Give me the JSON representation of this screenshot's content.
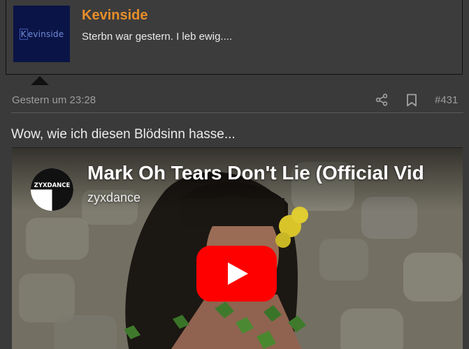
{
  "member": {
    "avatar_text": "evinside",
    "avatar_initial": "K",
    "username": "Kevinside",
    "title": "Sterbn war gestern. I leb ewig...."
  },
  "post": {
    "timestamp": "Gestern um 23:28",
    "number": "#431",
    "text": "Wow, wie ich diesen Blödsinn hasse..."
  },
  "video": {
    "title": "Mark Oh Tears Don't Lie (Official Vid",
    "channel": "zyxdance",
    "channel_logo_text": "ZYXDANCE"
  },
  "icons": {
    "share": "share-icon",
    "bookmark": "bookmark-icon",
    "play": "youtube-play-icon"
  },
  "colors": {
    "page_bg": "#3a3a3a",
    "username": "#e88e2a",
    "avatar_bg": "#0b1446",
    "muted_text": "#9d9d9d",
    "youtube_red": "#ff0000"
  }
}
